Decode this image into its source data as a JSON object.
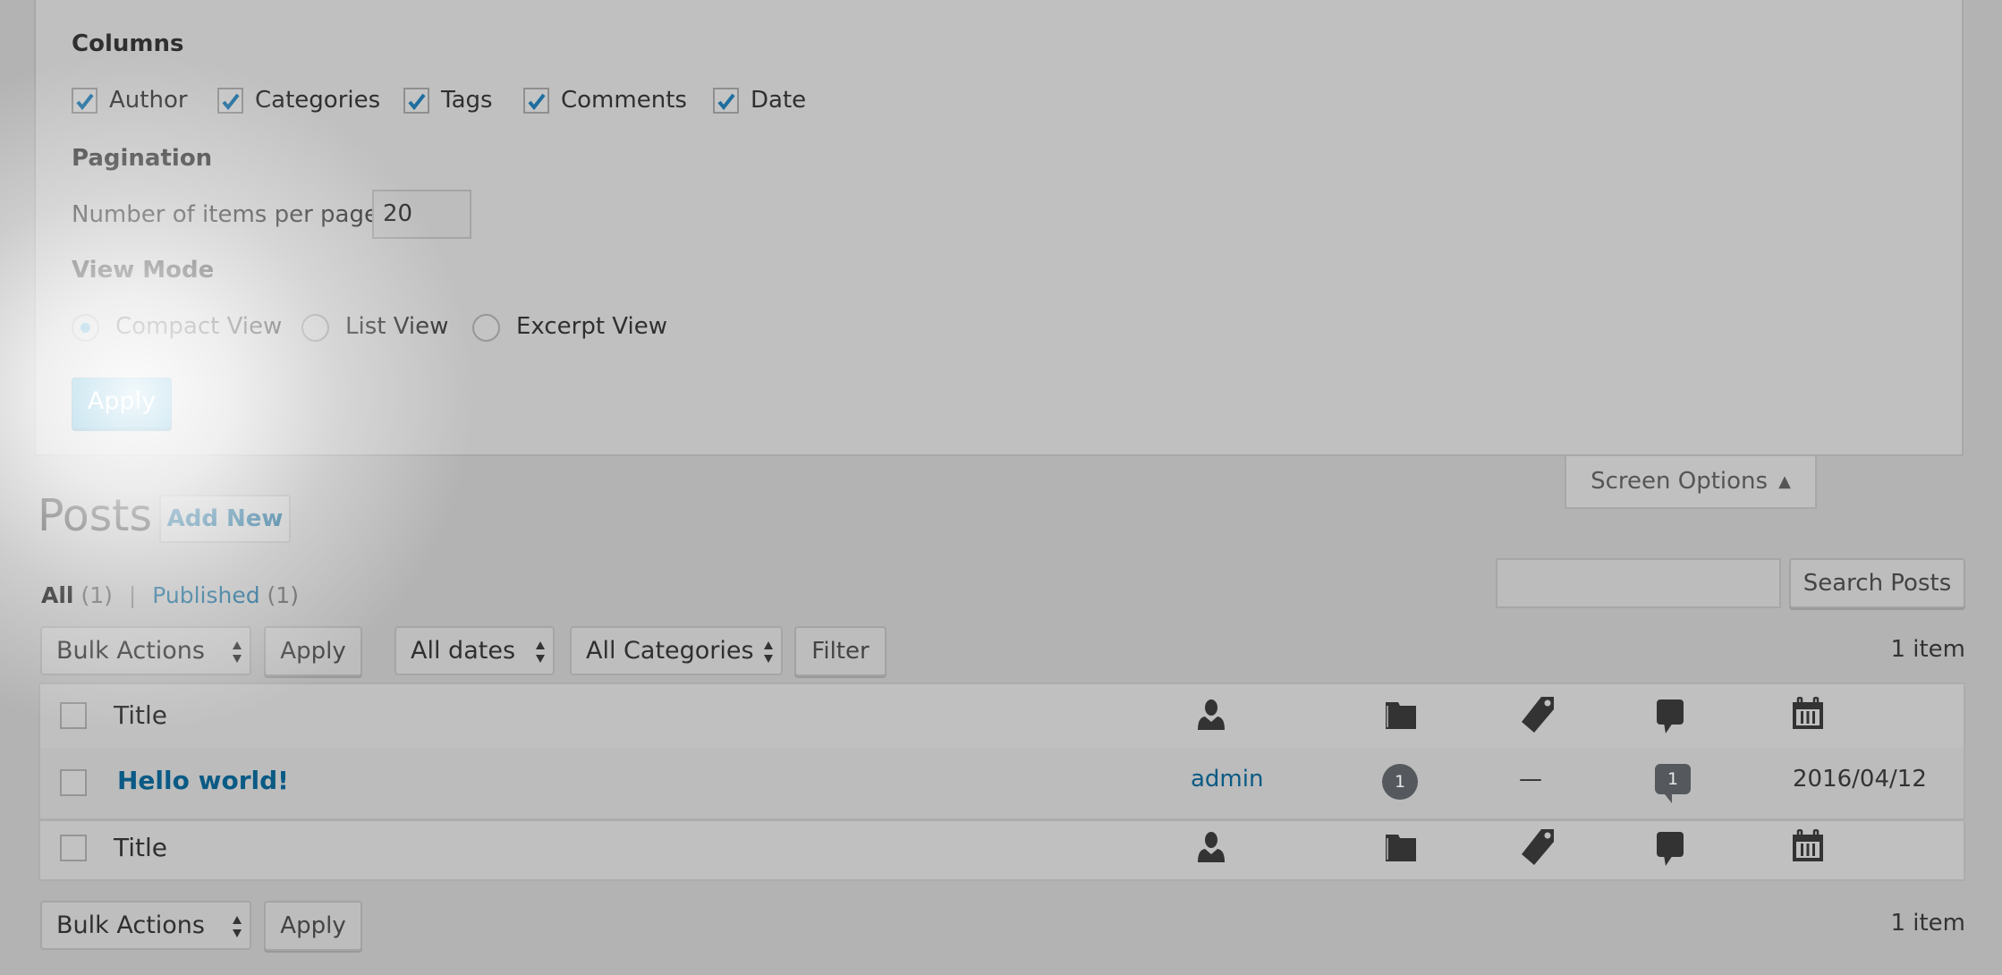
{
  "screen_options": {
    "columns_heading": "Columns",
    "columns": [
      {
        "label": "Author",
        "checked": true
      },
      {
        "label": "Categories",
        "checked": true
      },
      {
        "label": "Tags",
        "checked": true
      },
      {
        "label": "Comments",
        "checked": true
      },
      {
        "label": "Date",
        "checked": true
      }
    ],
    "pagination_heading": "Pagination",
    "items_per_page_label": "Number of items per page:",
    "items_per_page_value": "20",
    "view_mode_heading": "View Mode",
    "view_modes": [
      {
        "label": "Compact View",
        "selected": true
      },
      {
        "label": "List View",
        "selected": false
      },
      {
        "label": "Excerpt View",
        "selected": false
      }
    ],
    "apply_label": "Apply",
    "tab_label": "Screen Options",
    "tab_arrow": "▲"
  },
  "page": {
    "title": "Posts",
    "add_new_label": "Add New"
  },
  "views": {
    "all_label": "All",
    "all_count": "(1)",
    "separator": "|",
    "published_label": "Published",
    "published_count": "(1)"
  },
  "search": {
    "input_value": "",
    "button_label": "Search Posts"
  },
  "toolbar_top": {
    "bulk_actions": "Bulk Actions",
    "apply_label": "Apply",
    "dates_filter": "All dates",
    "categories_filter": "All Categories",
    "filter_label": "Filter",
    "item_count": "1 item"
  },
  "table": {
    "title_header": "Title",
    "column_icons": [
      "author-icon",
      "categories-icon",
      "tags-icon",
      "comments-icon",
      "date-icon"
    ],
    "rows": [
      {
        "title": "Hello world!",
        "author": "admin",
        "categories_count": "1",
        "tags": "—",
        "comments_count": "1",
        "date": "2016/04/12"
      }
    ]
  },
  "toolbar_bottom": {
    "bulk_actions": "Bulk Actions",
    "apply_label": "Apply",
    "item_count": "1 item"
  },
  "colors": {
    "primary_button": "#0085ba",
    "link": "#0a5a85",
    "checkmark": "#1e8cbe",
    "background": "#b3b3b3",
    "panel": "#c0c0c0"
  }
}
